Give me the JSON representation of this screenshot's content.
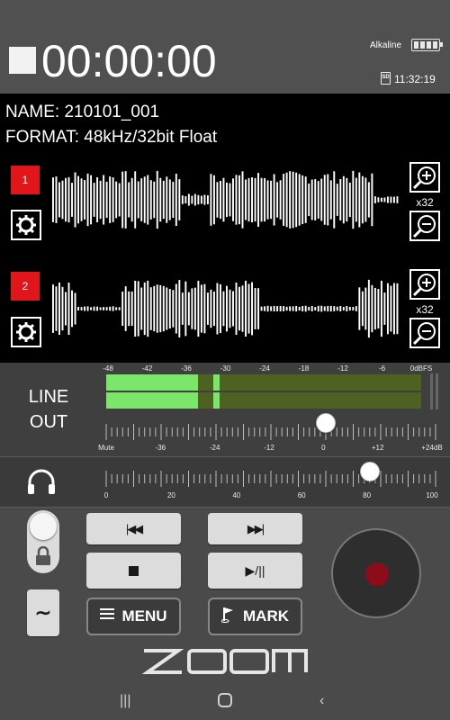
{
  "status": {
    "counter": "00:00:00",
    "battery_label": "Alkaline",
    "battery_level_fraction": 1.0,
    "clock": "11:32:19",
    "storage_icon": "sd-card-icon"
  },
  "file": {
    "name_label": "NAME: 210101_001",
    "format_label": "FORMAT: 48kHz/32bit Float"
  },
  "tracks": [
    {
      "number": "1",
      "zoom_label": "x32"
    },
    {
      "number": "2",
      "zoom_label": "x32"
    }
  ],
  "meter": {
    "scale": [
      "-48",
      "-42",
      "-36",
      "-30",
      "-24",
      "-18",
      "-12",
      "-6",
      "0dBFS"
    ],
    "level_fraction": 0.29,
    "peak_fraction": 0.34,
    "colors": {
      "level": "#7be66a",
      "background": "#4d6121"
    }
  },
  "line_out": {
    "label_line1": "LINE",
    "label_line2": "OUT",
    "scale": [
      "Mute",
      "-36",
      "-24",
      "-12",
      "0",
      "+12",
      "+24dB"
    ],
    "value_db": 0
  },
  "headphone": {
    "icon": "headphones-icon",
    "scale": [
      "0",
      "20",
      "40",
      "60",
      "80",
      "100"
    ],
    "value": 80
  },
  "transport": {
    "rewind_icon": "skip-back-icon",
    "forward_icon": "skip-forward-icon",
    "stop_icon": "stop-icon",
    "play_pause_icon": "play-pause-icon",
    "menu_label": "MENU",
    "mark_label": "MARK",
    "record_color": "#8b0d1a"
  },
  "brand": {
    "logo_text": "ZOOM"
  }
}
